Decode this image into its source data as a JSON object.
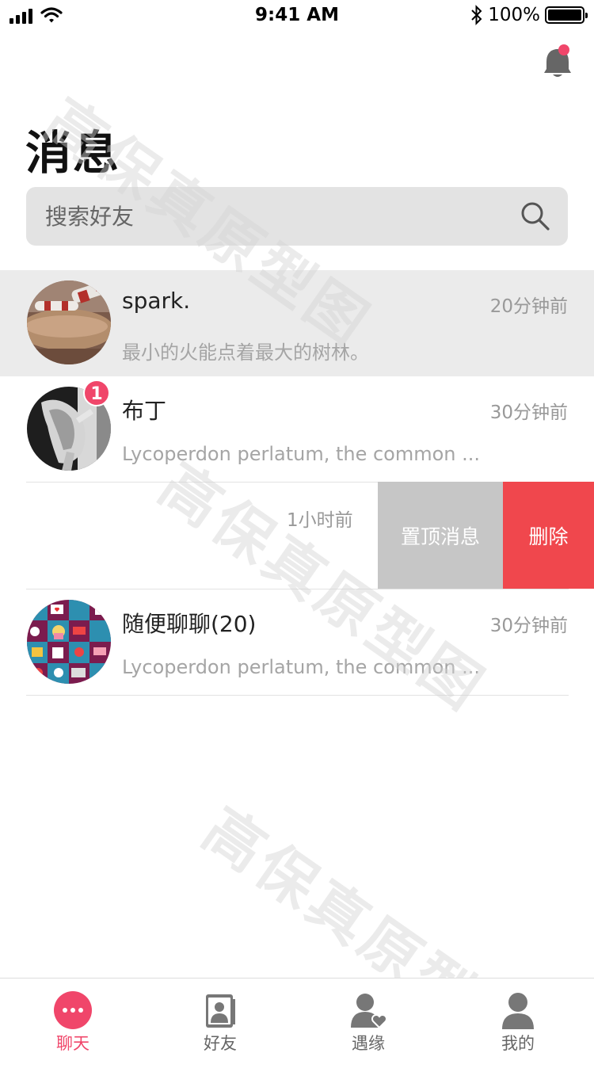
{
  "status_bar": {
    "time": "9:41 AM",
    "battery": "100%"
  },
  "header": {
    "title": "消息"
  },
  "search": {
    "placeholder": "搜索好友"
  },
  "conversations": [
    {
      "name": "spark.",
      "time": "20分钟前",
      "preview": "最小的火能点着最大的树林。"
    },
    {
      "name": "布丁",
      "time": "30分钟前",
      "preview": "Lycoperdon perlatum, the common ...",
      "unread": "1"
    },
    {
      "time": "1小时前"
    },
    {
      "name": "随便聊聊(20)",
      "time": "30分钟前",
      "preview": "Lycoperdon perlatum, the common ..."
    }
  ],
  "swipe_actions": {
    "pin": "置顶消息",
    "delete": "删除"
  },
  "watermark": "高保真原型图",
  "tabs": [
    {
      "label": "聊天",
      "icon": "chat-icon"
    },
    {
      "label": "好友",
      "icon": "contacts-icon"
    },
    {
      "label": "遇缘",
      "icon": "match-icon"
    },
    {
      "label": "我的",
      "icon": "profile-icon"
    }
  ],
  "colors": {
    "accent": "#f0466a",
    "delete": "#f0474d",
    "pin": "#c6c6c6",
    "active_row": "#ebebeb"
  }
}
